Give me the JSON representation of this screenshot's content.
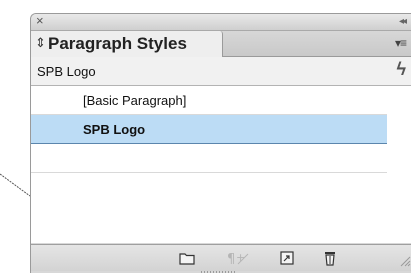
{
  "panel": {
    "close_glyph": "×",
    "collapse_glyph": "◂◂",
    "tab_updown_glyph": "⇕",
    "tab_title": "Paragraph Styles",
    "menu_glyph": "▾≡"
  },
  "current_style": {
    "name": "SPB Logo",
    "icon": "lightning-icon"
  },
  "styles": [
    {
      "label": "[Basic Paragraph]",
      "selected": false
    },
    {
      "label": "SPB Logo",
      "selected": true
    }
  ],
  "toolbar": {
    "icons": [
      "folder-icon",
      "clear-overrides-icon",
      "new-style-icon",
      "trash-icon"
    ]
  },
  "colors": {
    "selection": "#bcdcf5",
    "panel_bg": "#d8d8d8"
  }
}
